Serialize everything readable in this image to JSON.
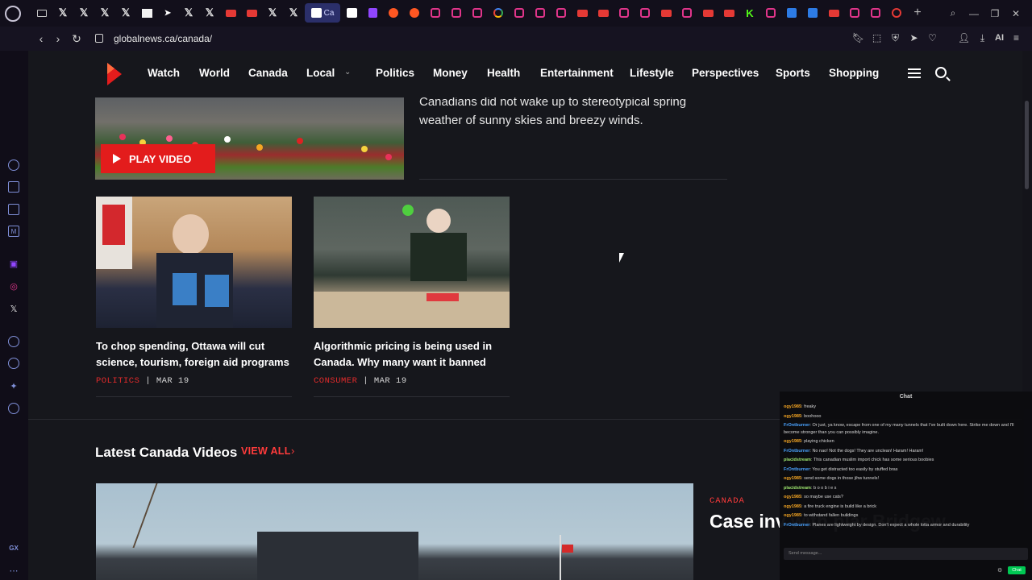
{
  "browser": {
    "url": "globalnews.ca/canada/",
    "active_tab_label": "Ca",
    "ai_label": "AI",
    "sidebar_bottom": "GX"
  },
  "site": {
    "nav": [
      {
        "label": "Watch"
      },
      {
        "label": "World"
      },
      {
        "label": "Canada"
      },
      {
        "label": "Local"
      },
      {
        "label": "Politics"
      },
      {
        "label": "Money"
      },
      {
        "label": "Health"
      },
      {
        "label": "Entertainment"
      },
      {
        "label": "Lifestyle"
      },
      {
        "label": "Perspectives"
      },
      {
        "label": "Sports"
      },
      {
        "label": "Shopping"
      }
    ],
    "brand_color": "#e31c1c"
  },
  "top_story": {
    "play_label": "PLAY VIDEO",
    "desc": "Canadians did not wake up to stereotypical spring weather of sunny skies and breezy winds."
  },
  "cards": [
    {
      "title": "To chop spending, Ottawa will cut science, tourism, foreign aid programs",
      "category": "POLITICS",
      "date": "MAR 19"
    },
    {
      "title": "Algorithmic pricing is being used in Canada. Why many want it banned",
      "category": "CONSUMER",
      "date": "MAR 19"
    }
  ],
  "videos_section": {
    "title": "Latest Canada Videos",
    "view_all": "VIEW ALL",
    "feature_category": "CANADA",
    "feature_title": "Case inv with plar Bridgew"
  },
  "chat": {
    "header": "Chat",
    "messages": [
      {
        "user": "ogy1985",
        "text": "freaky"
      },
      {
        "user": "ogy1985",
        "text": "boohooo"
      },
      {
        "user": "FrOntburner",
        "text": "Or just, ya know, escape from one of my many tunnels that I've built down here. Strike me down and I'll become stronger than you can possibly imagine."
      },
      {
        "user": "ogy1985",
        "text": "playing chicken"
      },
      {
        "user": "FrOntburner",
        "text": "No nao! Not the dogs! They are unclean! Haram! Haram!"
      },
      {
        "user": "placidstream",
        "text": "This canadian muslim import chick has some serious boobies"
      },
      {
        "user": "FrOntburner",
        "text": "You get distracted too easily by stuffed bras"
      },
      {
        "user": "ogy1985",
        "text": "send some dogs in those jihw tunnels!"
      },
      {
        "user": "placidstream",
        "text": "b o o b i e s"
      },
      {
        "user": "ogy1985",
        "text": "so maybe use cats?"
      },
      {
        "user": "ogy1985",
        "text": "a fire truck engine is build like a brick"
      },
      {
        "user": "ogy1985",
        "text": "to withstand fallen buildings"
      },
      {
        "user": "FrOntburner",
        "text": "Planes are lightweight by design. Don't expect a whole lotta armor and durability"
      }
    ],
    "input_placeholder": "Send message...",
    "send_label": "Chat"
  }
}
